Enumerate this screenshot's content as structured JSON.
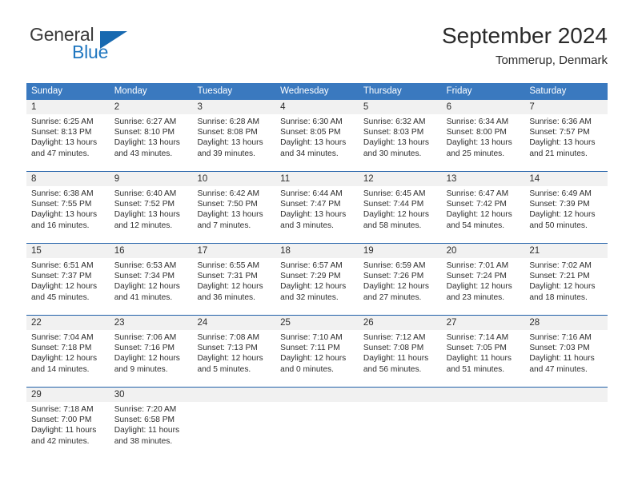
{
  "brand": {
    "name_primary": "General",
    "name_secondary": "Blue",
    "accent_color": "#1769b0"
  },
  "header": {
    "title": "September 2024",
    "subtitle": "Tommerup, Denmark"
  },
  "theme": {
    "header_row_bg": "#3a79bf",
    "week_divider": "#1f5fa8",
    "day_number_bg": "#f1f1f1",
    "text": "#2d2d2d"
  },
  "weekdays": [
    "Sunday",
    "Monday",
    "Tuesday",
    "Wednesday",
    "Thursday",
    "Friday",
    "Saturday"
  ],
  "weeks": [
    [
      {
        "day": "1",
        "sunrise": "Sunrise: 6:25 AM",
        "sunset": "Sunset: 8:13 PM",
        "daylight_1": "Daylight: 13 hours",
        "daylight_2": "and 47 minutes."
      },
      {
        "day": "2",
        "sunrise": "Sunrise: 6:27 AM",
        "sunset": "Sunset: 8:10 PM",
        "daylight_1": "Daylight: 13 hours",
        "daylight_2": "and 43 minutes."
      },
      {
        "day": "3",
        "sunrise": "Sunrise: 6:28 AM",
        "sunset": "Sunset: 8:08 PM",
        "daylight_1": "Daylight: 13 hours",
        "daylight_2": "and 39 minutes."
      },
      {
        "day": "4",
        "sunrise": "Sunrise: 6:30 AM",
        "sunset": "Sunset: 8:05 PM",
        "daylight_1": "Daylight: 13 hours",
        "daylight_2": "and 34 minutes."
      },
      {
        "day": "5",
        "sunrise": "Sunrise: 6:32 AM",
        "sunset": "Sunset: 8:03 PM",
        "daylight_1": "Daylight: 13 hours",
        "daylight_2": "and 30 minutes."
      },
      {
        "day": "6",
        "sunrise": "Sunrise: 6:34 AM",
        "sunset": "Sunset: 8:00 PM",
        "daylight_1": "Daylight: 13 hours",
        "daylight_2": "and 25 minutes."
      },
      {
        "day": "7",
        "sunrise": "Sunrise: 6:36 AM",
        "sunset": "Sunset: 7:57 PM",
        "daylight_1": "Daylight: 13 hours",
        "daylight_2": "and 21 minutes."
      }
    ],
    [
      {
        "day": "8",
        "sunrise": "Sunrise: 6:38 AM",
        "sunset": "Sunset: 7:55 PM",
        "daylight_1": "Daylight: 13 hours",
        "daylight_2": "and 16 minutes."
      },
      {
        "day": "9",
        "sunrise": "Sunrise: 6:40 AM",
        "sunset": "Sunset: 7:52 PM",
        "daylight_1": "Daylight: 13 hours",
        "daylight_2": "and 12 minutes."
      },
      {
        "day": "10",
        "sunrise": "Sunrise: 6:42 AM",
        "sunset": "Sunset: 7:50 PM",
        "daylight_1": "Daylight: 13 hours",
        "daylight_2": "and 7 minutes."
      },
      {
        "day": "11",
        "sunrise": "Sunrise: 6:44 AM",
        "sunset": "Sunset: 7:47 PM",
        "daylight_1": "Daylight: 13 hours",
        "daylight_2": "and 3 minutes."
      },
      {
        "day": "12",
        "sunrise": "Sunrise: 6:45 AM",
        "sunset": "Sunset: 7:44 PM",
        "daylight_1": "Daylight: 12 hours",
        "daylight_2": "and 58 minutes."
      },
      {
        "day": "13",
        "sunrise": "Sunrise: 6:47 AM",
        "sunset": "Sunset: 7:42 PM",
        "daylight_1": "Daylight: 12 hours",
        "daylight_2": "and 54 minutes."
      },
      {
        "day": "14",
        "sunrise": "Sunrise: 6:49 AM",
        "sunset": "Sunset: 7:39 PM",
        "daylight_1": "Daylight: 12 hours",
        "daylight_2": "and 50 minutes."
      }
    ],
    [
      {
        "day": "15",
        "sunrise": "Sunrise: 6:51 AM",
        "sunset": "Sunset: 7:37 PM",
        "daylight_1": "Daylight: 12 hours",
        "daylight_2": "and 45 minutes."
      },
      {
        "day": "16",
        "sunrise": "Sunrise: 6:53 AM",
        "sunset": "Sunset: 7:34 PM",
        "daylight_1": "Daylight: 12 hours",
        "daylight_2": "and 41 minutes."
      },
      {
        "day": "17",
        "sunrise": "Sunrise: 6:55 AM",
        "sunset": "Sunset: 7:31 PM",
        "daylight_1": "Daylight: 12 hours",
        "daylight_2": "and 36 minutes."
      },
      {
        "day": "18",
        "sunrise": "Sunrise: 6:57 AM",
        "sunset": "Sunset: 7:29 PM",
        "daylight_1": "Daylight: 12 hours",
        "daylight_2": "and 32 minutes."
      },
      {
        "day": "19",
        "sunrise": "Sunrise: 6:59 AM",
        "sunset": "Sunset: 7:26 PM",
        "daylight_1": "Daylight: 12 hours",
        "daylight_2": "and 27 minutes."
      },
      {
        "day": "20",
        "sunrise": "Sunrise: 7:01 AM",
        "sunset": "Sunset: 7:24 PM",
        "daylight_1": "Daylight: 12 hours",
        "daylight_2": "and 23 minutes."
      },
      {
        "day": "21",
        "sunrise": "Sunrise: 7:02 AM",
        "sunset": "Sunset: 7:21 PM",
        "daylight_1": "Daylight: 12 hours",
        "daylight_2": "and 18 minutes."
      }
    ],
    [
      {
        "day": "22",
        "sunrise": "Sunrise: 7:04 AM",
        "sunset": "Sunset: 7:18 PM",
        "daylight_1": "Daylight: 12 hours",
        "daylight_2": "and 14 minutes."
      },
      {
        "day": "23",
        "sunrise": "Sunrise: 7:06 AM",
        "sunset": "Sunset: 7:16 PM",
        "daylight_1": "Daylight: 12 hours",
        "daylight_2": "and 9 minutes."
      },
      {
        "day": "24",
        "sunrise": "Sunrise: 7:08 AM",
        "sunset": "Sunset: 7:13 PM",
        "daylight_1": "Daylight: 12 hours",
        "daylight_2": "and 5 minutes."
      },
      {
        "day": "25",
        "sunrise": "Sunrise: 7:10 AM",
        "sunset": "Sunset: 7:11 PM",
        "daylight_1": "Daylight: 12 hours",
        "daylight_2": "and 0 minutes."
      },
      {
        "day": "26",
        "sunrise": "Sunrise: 7:12 AM",
        "sunset": "Sunset: 7:08 PM",
        "daylight_1": "Daylight: 11 hours",
        "daylight_2": "and 56 minutes."
      },
      {
        "day": "27",
        "sunrise": "Sunrise: 7:14 AM",
        "sunset": "Sunset: 7:05 PM",
        "daylight_1": "Daylight: 11 hours",
        "daylight_2": "and 51 minutes."
      },
      {
        "day": "28",
        "sunrise": "Sunrise: 7:16 AM",
        "sunset": "Sunset: 7:03 PM",
        "daylight_1": "Daylight: 11 hours",
        "daylight_2": "and 47 minutes."
      }
    ],
    [
      {
        "day": "29",
        "sunrise": "Sunrise: 7:18 AM",
        "sunset": "Sunset: 7:00 PM",
        "daylight_1": "Daylight: 11 hours",
        "daylight_2": "and 42 minutes."
      },
      {
        "day": "30",
        "sunrise": "Sunrise: 7:20 AM",
        "sunset": "Sunset: 6:58 PM",
        "daylight_1": "Daylight: 11 hours",
        "daylight_2": "and 38 minutes."
      },
      {
        "day": "",
        "sunrise": "",
        "sunset": "",
        "daylight_1": "",
        "daylight_2": ""
      },
      {
        "day": "",
        "sunrise": "",
        "sunset": "",
        "daylight_1": "",
        "daylight_2": ""
      },
      {
        "day": "",
        "sunrise": "",
        "sunset": "",
        "daylight_1": "",
        "daylight_2": ""
      },
      {
        "day": "",
        "sunrise": "",
        "sunset": "",
        "daylight_1": "",
        "daylight_2": ""
      },
      {
        "day": "",
        "sunrise": "",
        "sunset": "",
        "daylight_1": "",
        "daylight_2": ""
      }
    ]
  ]
}
